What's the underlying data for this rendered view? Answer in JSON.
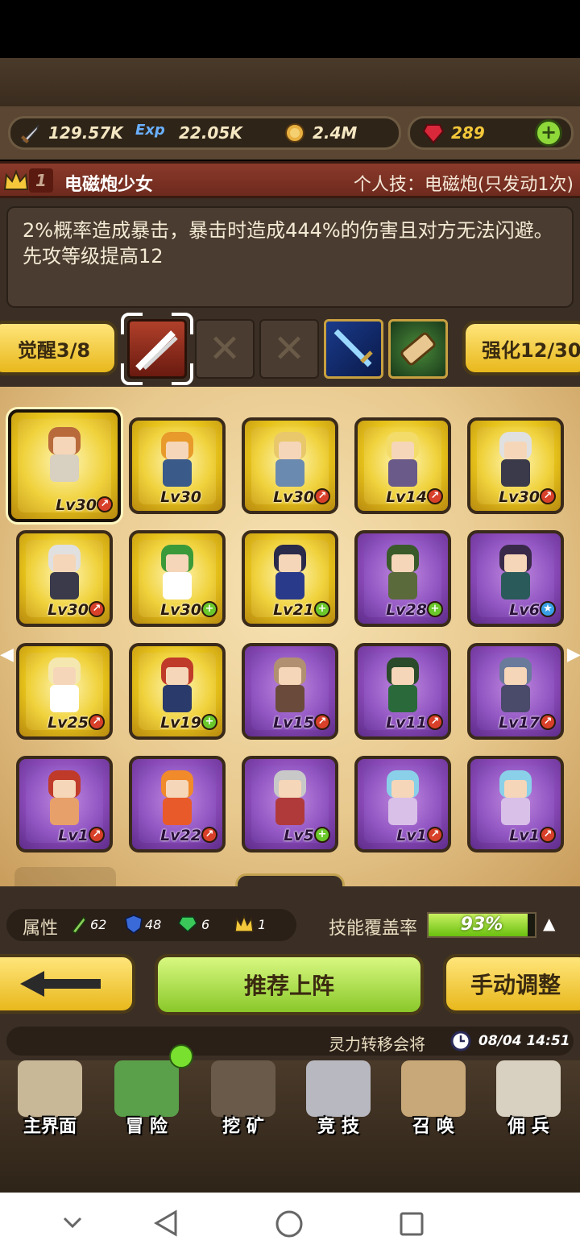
{
  "resources": {
    "sword_value": "129.57K",
    "exp_label": "Exp",
    "exp_value": "22.05K",
    "coin_value": "2.4M",
    "gem_value": "289"
  },
  "hero": {
    "rank": "1",
    "name": "电磁炮少女",
    "skill_title": "个人技：电磁炮(只发动1次)",
    "skill_desc": "2%概率造成暴击，暴击时造成444%的伤害且对方无法闪避。先攻等级提高12"
  },
  "awaken_label": "觉醒3/8",
  "enhance_label": "强化12/30",
  "cards": [
    {
      "lv": "Lv30",
      "rarity": "gold",
      "badge": "up",
      "hair": "#b86a3a",
      "cloth": "#d8d0c0",
      "selected": true
    },
    {
      "lv": "Lv30",
      "rarity": "gold",
      "badge": "",
      "hair": "#e89a2a",
      "cloth": "#3a5a8a"
    },
    {
      "lv": "Lv30",
      "rarity": "gold",
      "badge": "up",
      "hair": "#e8c86a",
      "cloth": "#6a8ab0"
    },
    {
      "lv": "Lv14",
      "rarity": "gold",
      "badge": "up",
      "hair": "#f4dc6a",
      "cloth": "#6a5a8a"
    },
    {
      "lv": "Lv30",
      "rarity": "gold",
      "badge": "up",
      "hair": "#e0e0e0",
      "cloth": "#3a3a4a"
    },
    {
      "lv": "Lv30",
      "rarity": "gold",
      "badge": "up",
      "hair": "#e0e0e0",
      "cloth": "#3a3a4a"
    },
    {
      "lv": "Lv30",
      "rarity": "gold",
      "badge": "plus",
      "hair": "#3a9a3a",
      "cloth": "#ffffff"
    },
    {
      "lv": "Lv21",
      "rarity": "gold",
      "badge": "plus",
      "hair": "#2a2a4a",
      "cloth": "#2a3a8a"
    },
    {
      "lv": "Lv28",
      "rarity": "purple",
      "badge": "plus",
      "hair": "#3a5a2a",
      "cloth": "#5a6a3a"
    },
    {
      "lv": "Lv6",
      "rarity": "purple",
      "badge": "star",
      "hair": "#3a2a4a",
      "cloth": "#2a5a5a"
    },
    {
      "lv": "Lv25",
      "rarity": "gold",
      "badge": "up",
      "hair": "#f4e8b0",
      "cloth": "#ffffff"
    },
    {
      "lv": "Lv19",
      "rarity": "gold",
      "badge": "plus",
      "hair": "#c03a2a",
      "cloth": "#2a3a6a"
    },
    {
      "lv": "Lv15",
      "rarity": "purple",
      "badge": "up",
      "hair": "#b09070",
      "cloth": "#6a4a3a"
    },
    {
      "lv": "Lv11",
      "rarity": "purple",
      "badge": "up",
      "hair": "#2a4a2a",
      "cloth": "#2a6a3a"
    },
    {
      "lv": "Lv17",
      "rarity": "purple",
      "badge": "up",
      "hair": "#6a7a9a",
      "cloth": "#4a4a6a"
    },
    {
      "lv": "Lv1",
      "rarity": "purple",
      "badge": "up",
      "hair": "#c03a2a",
      "cloth": "#e8a06a"
    },
    {
      "lv": "Lv22",
      "rarity": "purple",
      "badge": "up",
      "hair": "#f08a2a",
      "cloth": "#e85a2a"
    },
    {
      "lv": "Lv5",
      "rarity": "purple",
      "badge": "plus",
      "hair": "#c8c8c8",
      "cloth": "#b03a3a"
    },
    {
      "lv": "Lv1",
      "rarity": "purple",
      "badge": "up",
      "hair": "#8ad0e8",
      "cloth": "#d8c0e8"
    },
    {
      "lv": "Lv1",
      "rarity": "purple",
      "badge": "up",
      "hair": "#8ad0e8",
      "cloth": "#d8c0e8"
    }
  ],
  "attributes": {
    "label": "属性",
    "power": "62",
    "defense": "48",
    "gem": "6",
    "crown": "1"
  },
  "coverage": {
    "label": "技能覆盖率",
    "value": "93%",
    "fraction": 0.93
  },
  "buttons": {
    "recommend": "推荐上阵",
    "manual": "手动调整"
  },
  "notice": {
    "text": "灵力转移会将",
    "time": "08/04 14:51"
  },
  "nav": [
    {
      "label": "主界面",
      "icon": "map-scroll-icon"
    },
    {
      "label": "冒 险",
      "icon": "island-icon"
    },
    {
      "label": "挖 矿",
      "icon": "pickaxe-icon"
    },
    {
      "label": "竞 技",
      "icon": "crossed-swords-icon"
    },
    {
      "label": "召 唤",
      "icon": "summon-scroll-icon"
    },
    {
      "label": "佣 兵",
      "icon": "tent-icon"
    }
  ],
  "colors": {
    "gold_card": "#e6c21a",
    "purple_card": "#8a4ab8",
    "green_button": "#a8e040",
    "coverage_bar": "#8fe020"
  }
}
